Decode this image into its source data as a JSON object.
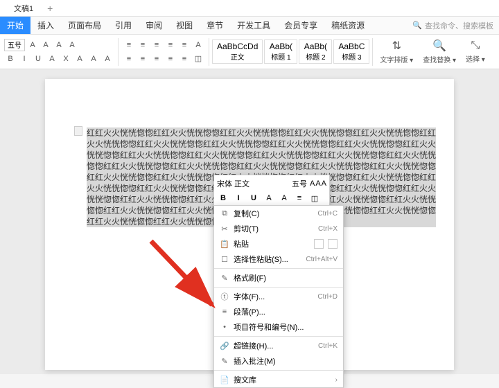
{
  "titlebar": {
    "doc_title": "文稿1",
    "plus": "+"
  },
  "menubar": {
    "tabs": [
      "开始",
      "插入",
      "页面布局",
      "引用",
      "审阅",
      "视图",
      "章节",
      "开发工具",
      "会员专享",
      "稿纸资源"
    ],
    "active_index": 0,
    "search_placeholder": "查找命令、搜索模板",
    "search_icon": "🔍"
  },
  "ribbon": {
    "font_size": "五号",
    "format_icons": [
      "A",
      "A",
      "A",
      "A"
    ],
    "color_icons": [
      "B",
      "I",
      "U",
      "A",
      "X",
      "A",
      "A",
      "A"
    ],
    "para_icons_top": [
      "≡",
      "≡",
      "≡",
      "≡",
      "≡",
      "A"
    ],
    "para_icons_bot": [
      "≡",
      "≡",
      "≡",
      "≡",
      "≡",
      "◫"
    ],
    "styles": [
      {
        "preview": "AaBbCcDd",
        "name": "正文"
      },
      {
        "preview": "AaBb(",
        "name": "标题 1"
      },
      {
        "preview": "AaBb(",
        "name": "标题 2"
      },
      {
        "preview": "AaBbC",
        "name": "标题 3"
      }
    ],
    "right": [
      {
        "icon": "⇅",
        "label": "文字排版"
      },
      {
        "icon": "🔍",
        "label": "查找替换"
      },
      {
        "icon": "⤡",
        "label": "选择"
      }
    ]
  },
  "doc": {
    "repeat_unit": "红红火火恍恍惚惚"
  },
  "minitoolbar": {
    "font_name": "宋体 正文",
    "font_size": "五号",
    "row1_icons": [
      "A",
      "A",
      "A"
    ],
    "row2": [
      "B",
      "I",
      "U",
      "A",
      "A",
      "≡",
      "◫"
    ]
  },
  "ctxmenu": {
    "items": [
      {
        "icon": "⧉",
        "label": "复制(C)",
        "shortcut": "Ctrl+C"
      },
      {
        "icon": "✂",
        "label": "剪切(T)",
        "shortcut": "Ctrl+X"
      },
      {
        "icon": "📋",
        "label": "粘贴",
        "shortcut": "",
        "paste_extra": true
      },
      {
        "icon": "☐",
        "label": "选择性粘贴(S)...",
        "shortcut": "Ctrl+Alt+V"
      },
      {
        "sep": true
      },
      {
        "icon": "✎",
        "label": "格式刷(F)",
        "shortcut": ""
      },
      {
        "sep": true
      },
      {
        "icon": "ⓣ",
        "label": "字体(F)...",
        "shortcut": "Ctrl+D"
      },
      {
        "icon": "≡",
        "label": "段落(P)...",
        "shortcut": ""
      },
      {
        "icon": "•",
        "label": "项目符号和编号(N)...",
        "shortcut": ""
      },
      {
        "sep": true
      },
      {
        "icon": "🔗",
        "label": "超链接(H)...",
        "shortcut": "Ctrl+K"
      },
      {
        "icon": "✎",
        "label": "插入批注(M)",
        "shortcut": ""
      },
      {
        "sep": true
      },
      {
        "icon": "📄",
        "label": "搜文库",
        "shortcut": "",
        "arrow": "›"
      }
    ]
  }
}
